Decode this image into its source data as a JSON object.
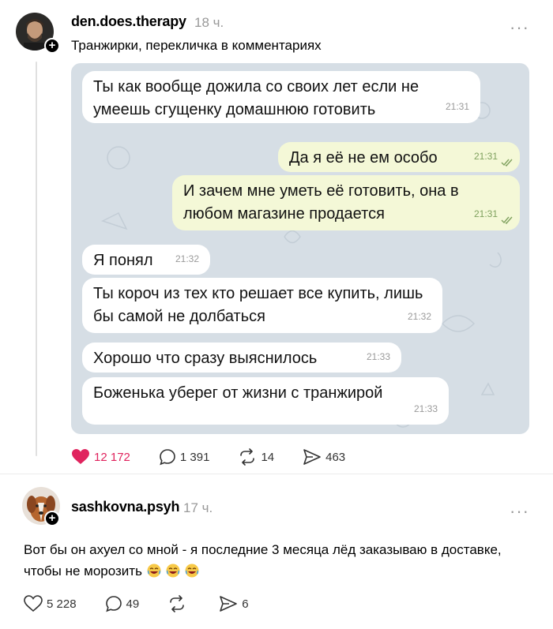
{
  "post": {
    "username": "den.does.therapy",
    "time": "18 ч.",
    "more": "···",
    "caption": "Транжирки, перекличка в комментариях",
    "messages": [
      {
        "dir": "in",
        "text": "Ты как вообще дожила со своих лет если не умеешь сгущенку домашнюю готовить",
        "time": "21:31"
      },
      {
        "dir": "out",
        "text": "Да я её не ем особо",
        "time": "21:31"
      },
      {
        "dir": "out",
        "text": "И зачем мне уметь её готовить, она в любом магазине продается",
        "time": "21:31"
      },
      {
        "dir": "in",
        "text": "Я понял",
        "time": "21:32"
      },
      {
        "dir": "in",
        "text": "Ты короч из тех кто решает все купить, лишь бы самой не долбаться",
        "time": "21:32"
      },
      {
        "dir": "in",
        "text": "Хорошо что сразу выяснилось",
        "time": "21:33"
      },
      {
        "dir": "in",
        "text": "Боженька уберег от жизни с транжирой",
        "time": "21:33"
      }
    ],
    "actions": {
      "likes": "12 172",
      "comments": "1 391",
      "reposts": "14",
      "shares": "463"
    },
    "like_color": "#e0245e"
  },
  "comment": {
    "username": "sashkovna.psyh",
    "time": "17 ч.",
    "more": "···",
    "text": "Вот бы он ахуел со мной - я последние 3 месяца лёд заказываю в доставке, чтобы не морозить",
    "emojis": [
      "laughing-emoji",
      "laughing-emoji",
      "laughing-emoji"
    ],
    "actions": {
      "likes": "5 228",
      "comments": "49",
      "reposts": "",
      "shares": "6"
    }
  }
}
